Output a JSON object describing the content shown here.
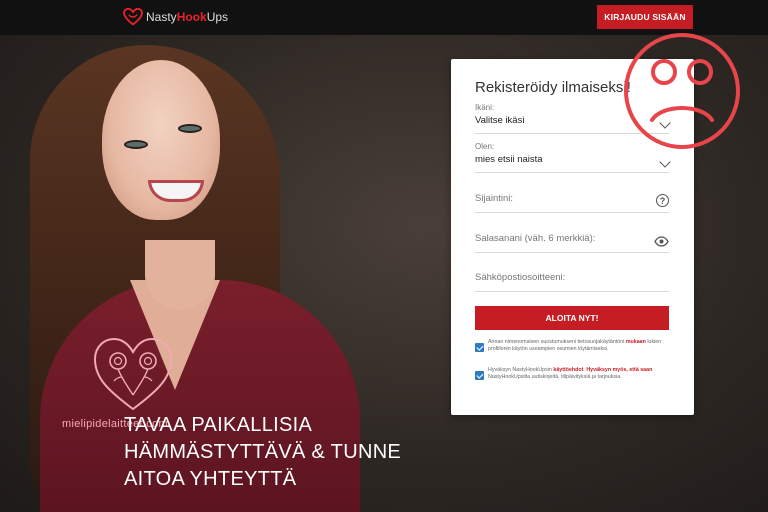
{
  "header": {
    "logo": {
      "part1": "Nasty",
      "part2": "Hook",
      "part3": "Ups",
      "icon": "heart-logo-icon",
      "accent_color": "#e8232a"
    },
    "login_button": "KIRJAUDU SISÄÄN"
  },
  "form": {
    "title": "Rekisteröidy ilmaiseksi!",
    "age": {
      "label": "Ikäni:",
      "value": "Valitse ikäsi"
    },
    "gender": {
      "label": "Olen:",
      "value": "mies etsii naista"
    },
    "location": {
      "placeholder": "Sijaintini:"
    },
    "password": {
      "placeholder": "Salasanani (väh. 6 merkkiä):"
    },
    "email": {
      "placeholder": "Sähköpostiosoitteeni:"
    },
    "submit": "ALOITA NYT!",
    "consent1": {
      "text_a": "Annan nimenomaisen suostumukseni tietosuojakäytäntöni",
      "link": "mukaan",
      "text_b": "lukien profiilonin käytön useampien osumien löytämiseksi."
    },
    "consent2": {
      "text_a": "Hyväksyn NastyHookUpsin",
      "link1": "käyttöehdot",
      "sep": ". ",
      "link2": "Hyväksyn myös, että saan",
      "text_b": "NastyHookUpsilta uutiskirjeitä, tilipäivityksiä ja tarjouksia."
    },
    "accent_color": "#c51d23"
  },
  "hero": {
    "headline": [
      "TAVAA PAIKALLISIA",
      "HÄMMÄSTYTTÄVÄ & TUNNE",
      "AITOA YHTEYTTÄ"
    ]
  },
  "watermark": {
    "text": "mielipidelaitteet.com",
    "icon": "heart-roses-icon"
  },
  "overlay": {
    "icon": "sad-face-icon",
    "color": "#e8454a"
  }
}
